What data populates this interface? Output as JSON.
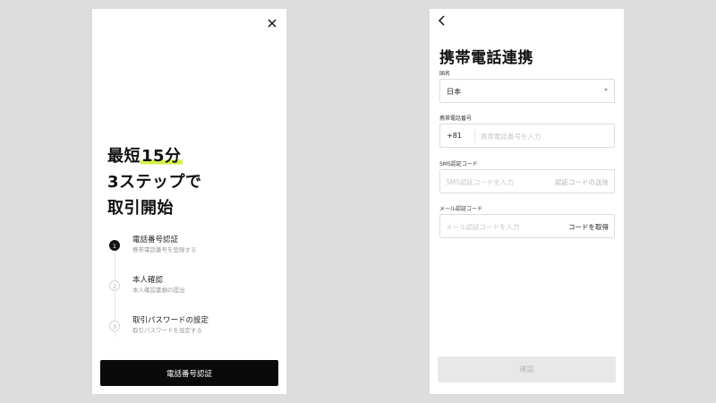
{
  "onboarding": {
    "close_label": "×",
    "headline": {
      "line1_prefix": "最短",
      "line1_highlight": "15分",
      "line2": "3ステップで",
      "line3": "取引開始"
    },
    "steps": [
      {
        "number": "1",
        "title": "電話番号認証",
        "description": "携帯電話番号を登録する",
        "active": true
      },
      {
        "number": "2",
        "title": "本人確認",
        "description": "本人確認書類の提出",
        "active": false
      },
      {
        "number": "3",
        "title": "取引パスワードの設定",
        "description": "取引パスワードを設定する",
        "active": false
      }
    ],
    "primary_button": "電話番号認証",
    "highlight_color": "#d4f04a"
  },
  "phone_link": {
    "title": "携帯電話連携",
    "country": {
      "label": "国名",
      "value": "日本"
    },
    "phone": {
      "label": "携帯電話番号",
      "prefix": "+81",
      "placeholder": "携帯電話番号を入力"
    },
    "sms": {
      "label": "SMS認証コード",
      "placeholder": "SMS認証コードを入力",
      "action": "認証コードの送信"
    },
    "email": {
      "label": "メール認証コード",
      "placeholder": "メール認証コードを入力",
      "action": "コードを取得"
    },
    "confirm_button": "確認"
  }
}
